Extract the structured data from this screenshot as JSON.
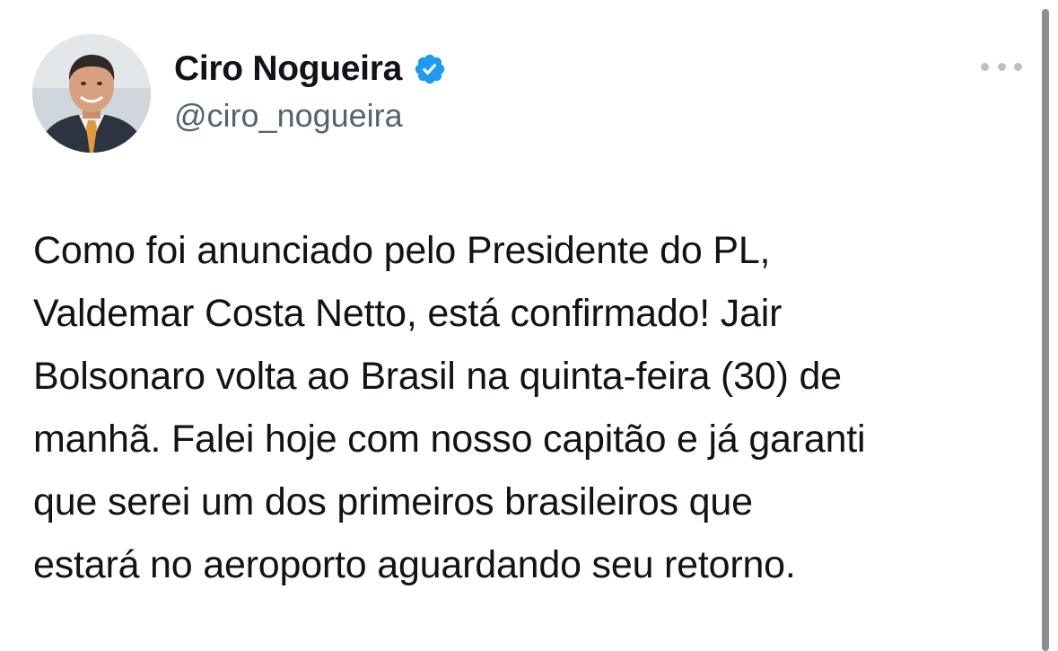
{
  "author": {
    "display_name": "Ciro Nogueira",
    "handle": "@ciro_nogueira",
    "verified": true,
    "avatar_icon": "profile-photo-avatar"
  },
  "actions": {
    "more_icon": "more-horizontal-icon"
  },
  "tweet": {
    "lines": [
      "Como foi anunciado pelo Presidente do PL,",
      "Valdemar Costa Netto, está confirmado! Jair",
      "Bolsonaro volta ao Brasil na quinta-feira (30) de",
      "manhã. Falei hoje com nosso capitão e já garanti",
      "que serei um dos primeiros brasileiros que",
      "estará no aeroporto aguardando seu retorno."
    ]
  },
  "colors": {
    "text_primary": "#0f1419",
    "text_secondary": "#536471",
    "verified_blue": "#1d9bf0",
    "more_dots": "#b9c2ca"
  }
}
